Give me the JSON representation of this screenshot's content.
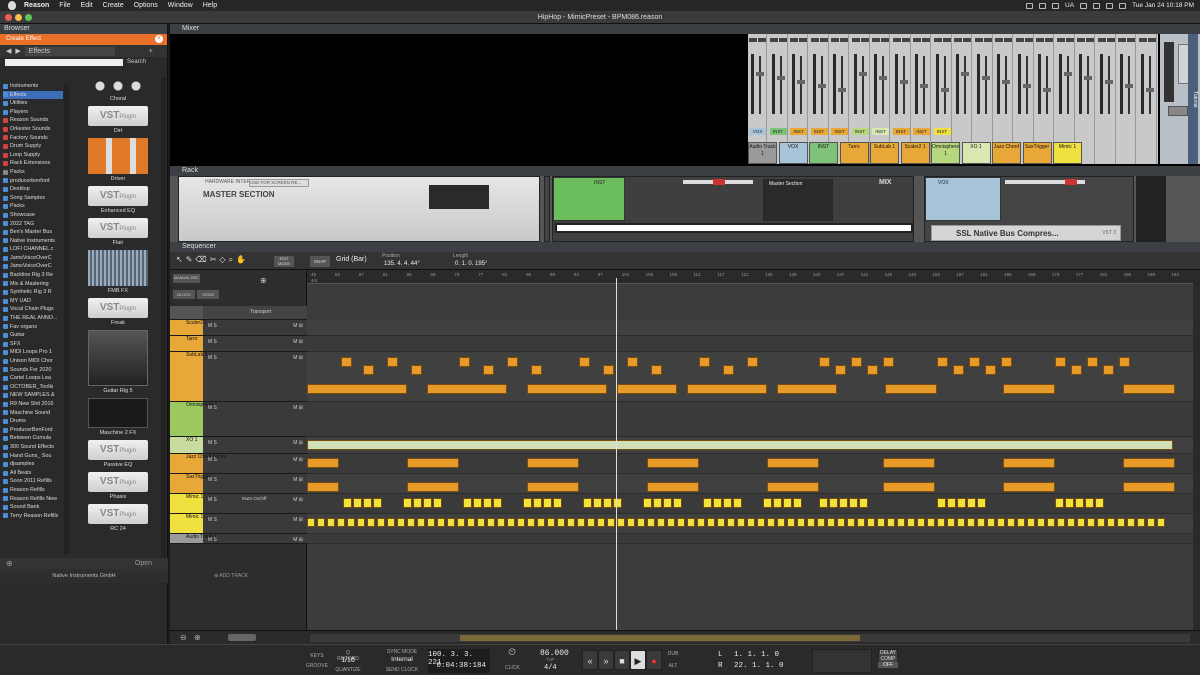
{
  "menubar": {
    "app": "Reason",
    "items": [
      "File",
      "Edit",
      "Create",
      "Options",
      "Window",
      "Help"
    ],
    "clock": "Tue Jan 24  10:18 PM",
    "lang": "UA"
  },
  "title": "HipHop - MimicPreset - BPM086.reason",
  "browser": {
    "title": "Browser",
    "create_label": "Create Effect",
    "nav_label": "Effects",
    "search_label": "Search",
    "categories": [
      "Instruments",
      "Effects",
      "Utilities",
      "Players",
      "Reason Sounds",
      "Orkester Sounds",
      "Factory Sounds",
      "Drum Supply",
      "Loop Supply",
      "Rack Extensions",
      "Packs",
      "producerbenford",
      "Desktop",
      "Song Samples",
      "Packs",
      "Showcase",
      "2022 TAG",
      "Ben's Master Bus",
      "Native Instruments",
      "LOFI CHANNEL.c",
      "JamsVoiceOverC",
      "JamsVoiceOverC",
      "Backline Rig 3 Re",
      "Mix & Mastering",
      "Synthetic Rig 3 R",
      "MY UAD",
      "Vocal Chain Plugs",
      "THE REAL ANNO...",
      "Fav organs",
      "Guitar",
      "SFX",
      "MIDI Loops Pro 1",
      "Unison MIDI Chor",
      "Sounds For 2020",
      "Cartel Loops Lea",
      "OCTOBER_Toolki",
      "NEW SAMPLES &",
      "R9 New Shit 2016",
      "Maschine Sound",
      "Drums",
      "ProducerBenFord",
      "Between Cumula",
      "300 Sound Effects",
      "Hand Guns_ Sou",
      "djsamples",
      "All Beats",
      "Soon 2011 Refills",
      "Reason Refills",
      "Reason Refills New",
      "Sound Bank",
      "Terry Reason Refills"
    ],
    "tiles": [
      {
        "label": "Choral",
        "kind": "knobs"
      },
      {
        "label": "Dirt",
        "kind": "vst"
      },
      {
        "label": "Driver",
        "kind": "orange"
      },
      {
        "label": "Enhanced EQ",
        "kind": "vst"
      },
      {
        "label": "Flair",
        "kind": "vst"
      },
      {
        "label": "FMB FX",
        "kind": "screen"
      },
      {
        "label": "Freak",
        "kind": "vst"
      },
      {
        "label": "Guitar Rig 5",
        "kind": "dark"
      },
      {
        "label": "Maschine 2 FX",
        "kind": "dark2"
      },
      {
        "label": "Passive EQ",
        "kind": "vst"
      },
      {
        "label": "Phasis",
        "kind": "vst"
      },
      {
        "label": "RC 24",
        "kind": "vst"
      }
    ],
    "vst_text": "VST",
    "vst_sub": "Plugin",
    "open_label": "Open",
    "footer": "Native Instruments GmbH"
  },
  "mixer": {
    "title": "Mixer",
    "side_label": "Tutorial",
    "strip_label": "VOX",
    "channels": [
      {
        "name": "Audio Track 1",
        "color": "#9a9a9a"
      },
      {
        "name": "VOX",
        "color": "#a8c4d8"
      },
      {
        "name": "INST",
        "color": "#7fc27a"
      },
      {
        "name": "Tarro",
        "color": "#e8a838"
      },
      {
        "name": "SubLab 1",
        "color": "#e8a838"
      },
      {
        "name": "Scaler2 1",
        "color": "#e8a838"
      },
      {
        "name": "Omnisphere 1",
        "color": "#b8d880"
      },
      {
        "name": "XO 1",
        "color": "#d8e8b0"
      },
      {
        "name": "Jazz Chord",
        "color": "#e8a838"
      },
      {
        "name": "SaxTrigger",
        "color": "#e8a838"
      },
      {
        "name": "Mimic 1",
        "color": "#f0e040"
      }
    ],
    "inst_label": "INST"
  },
  "rack": {
    "title": "Rack",
    "hw_label": "HARDWARE INTERFACE",
    "master_label": "MASTER SECTION",
    "use_label": "USE FOR SCREEN RE...",
    "inst_label": "INST",
    "mix_label": "MIX",
    "master_section_label": "Master Section",
    "vox_label": "VOX",
    "ssl_label": "SSL Native Bus Compres...",
    "vst3_label": "VST 3"
  },
  "sequencer": {
    "title": "Sequencer",
    "snap_label": "SNAP",
    "grid_label": "Grid (Bar)",
    "position_label": "Position",
    "position_value": "135.  4.  4.  44°",
    "length_label": "Length",
    "length_value": "0.  1.  0. 195°",
    "block_label": "BLOCK",
    "song_label": "SONG",
    "manual_rec": "MANUAL REC",
    "transport_track": "Transport",
    "add_track": "ADD TRACK",
    "mute_label": "Mute On/Off",
    "ruler": [
      "49",
      "53",
      "57",
      "61",
      "65",
      "69",
      "73",
      "77",
      "81",
      "85",
      "89",
      "93",
      "97",
      "101",
      "105",
      "109",
      "113",
      "117",
      "121",
      "125",
      "129",
      "133",
      "137",
      "141",
      "145",
      "149",
      "153",
      "157",
      "161",
      "165",
      "169",
      "173",
      "177",
      "181",
      "185",
      "189",
      "193",
      "197"
    ],
    "time_sig": "4/4",
    "tracks": [
      {
        "name": "Scaler2 1",
        "color": "#e8a838",
        "h": 16
      },
      {
        "name": "Tarro",
        "color": "#e8a838",
        "h": 16
      },
      {
        "name": "SubLab 1",
        "color": "#e8a838",
        "h": 50
      },
      {
        "name": "Omnisphere 1",
        "color": "#9cc860",
        "h": 35
      },
      {
        "name": "XO 1",
        "color": "#c8dca0",
        "h": 17
      },
      {
        "name": "Jazz Chord Slices",
        "color": "#e8a838",
        "h": 20
      },
      {
        "name": "SaxTrigger",
        "color": "#e8a838",
        "h": 20
      },
      {
        "name": "Mimic 1",
        "color": "#f0e040",
        "h": 20
      },
      {
        "name": "Mimic 1",
        "color": "#f0e040",
        "h": 20
      },
      {
        "name": "Audio Track 1",
        "color": "#9a9a9a",
        "h": 10
      }
    ]
  },
  "transport": {
    "keys": "KEYS",
    "groove": "GROOVE",
    "qrecord": "Q RECORD",
    "quantize": "QUANTIZE",
    "quant_value": "1/16",
    "sync_mode": "SYNC MODE",
    "sync_value": "Internal",
    "send_clock": "SEND CLOCK",
    "position": "100.  3.  3. 221",
    "time": "0:04:38:184",
    "bpm": "86.000",
    "tap": "TAP",
    "sig": "4/4",
    "click": "CLICK",
    "pre": "PRE",
    "dub": "DUB",
    "alt": "ALT",
    "l_label": "L",
    "r_label": "R",
    "l_value": "1.  1.  1.   0",
    "r_value": "22.  1.  1.   0",
    "delay_comp": "DELAY COMP",
    "off": "OFF",
    "zoom": "ZOOM"
  }
}
